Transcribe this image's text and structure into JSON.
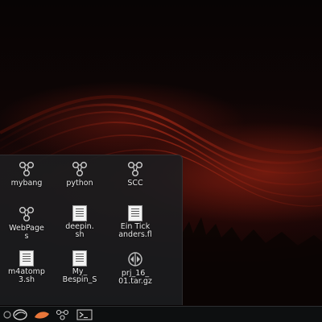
{
  "desktop": {
    "wallpaper": "dark red particle wave",
    "accent_color": "#b02810"
  },
  "launcher": {
    "items": [
      {
        "label": "mybang",
        "icon": "network-share-icon"
      },
      {
        "label": "python",
        "icon": "network-share-icon"
      },
      {
        "label": "SCC",
        "icon": "network-share-icon"
      },
      {
        "label": "WebPage\ns",
        "icon": "network-share-icon"
      },
      {
        "label": "deepin.\nsh",
        "icon": "script-file-icon"
      },
      {
        "label": "Ein Tick\nanders.fl",
        "icon": "image-thumbnail-icon"
      },
      {
        "label": "m4atomp\n3.sh",
        "icon": "script-file-icon"
      },
      {
        "label": "My_\nBespin_S",
        "icon": "document-thumbnail-icon"
      },
      {
        "label": "prj_16_\n01.tar.gz",
        "icon": "archive-icon"
      }
    ]
  },
  "taskbar": {
    "items": [
      {
        "name": "launcher-icon"
      },
      {
        "name": "browser-icon"
      },
      {
        "name": "wedge-icon"
      },
      {
        "name": "network-icon"
      },
      {
        "name": "terminal-icon",
        "label": ">_"
      }
    ]
  }
}
